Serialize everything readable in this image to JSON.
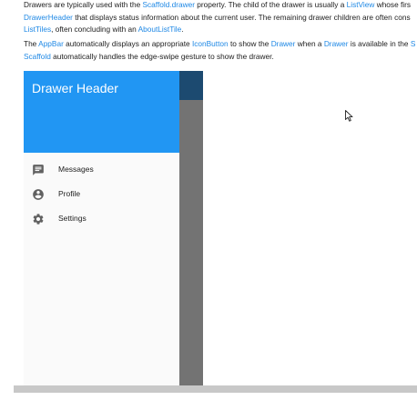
{
  "doc": {
    "p1": {
      "l1": [
        {
          "t": "Drawers are typically used with the "
        },
        {
          "t": "Scaffold.drawer",
          "link": true
        },
        {
          "t": " property. The child of the drawer is usually a "
        },
        {
          "t": "ListView",
          "link": true
        },
        {
          "t": " whose firs"
        }
      ],
      "l2": [
        {
          "t": "DrawerHeader",
          "link": true
        },
        {
          "t": " that displays status information about the current user. The remaining drawer children are often cons"
        }
      ],
      "l3": [
        {
          "t": "ListTiles",
          "link": true
        },
        {
          "t": ", often concluding with an "
        },
        {
          "t": "AboutListTile",
          "link": true
        },
        {
          "t": "."
        }
      ]
    },
    "p2": {
      "l1": [
        {
          "t": "The "
        },
        {
          "t": "AppBar",
          "link": true
        },
        {
          "t": " automatically displays an appropriate "
        },
        {
          "t": "IconButton",
          "link": true
        },
        {
          "t": " to show the "
        },
        {
          "t": "Drawer",
          "link": true
        },
        {
          "t": " when a "
        },
        {
          "t": "Drawer",
          "link": true
        },
        {
          "t": " is available in the "
        },
        {
          "t": "S",
          "link": true
        }
      ],
      "l2": [
        {
          "t": "Scaffold",
          "link": true
        },
        {
          "t": " automatically handles the edge-swipe gesture to show the drawer."
        }
      ]
    }
  },
  "drawer": {
    "header_title": "Drawer Header",
    "items": [
      {
        "label": "Messages",
        "icon": "message-icon"
      },
      {
        "label": "Profile",
        "icon": "account-circle-icon"
      },
      {
        "label": "Settings",
        "icon": "gear-icon"
      }
    ]
  },
  "colors": {
    "link": "#1e88e5",
    "drawer_header": "#2196f3",
    "appbar": "#1c4a70",
    "scrim": "#737373",
    "drawer_bg": "#fafafa",
    "icon": "#616161"
  }
}
